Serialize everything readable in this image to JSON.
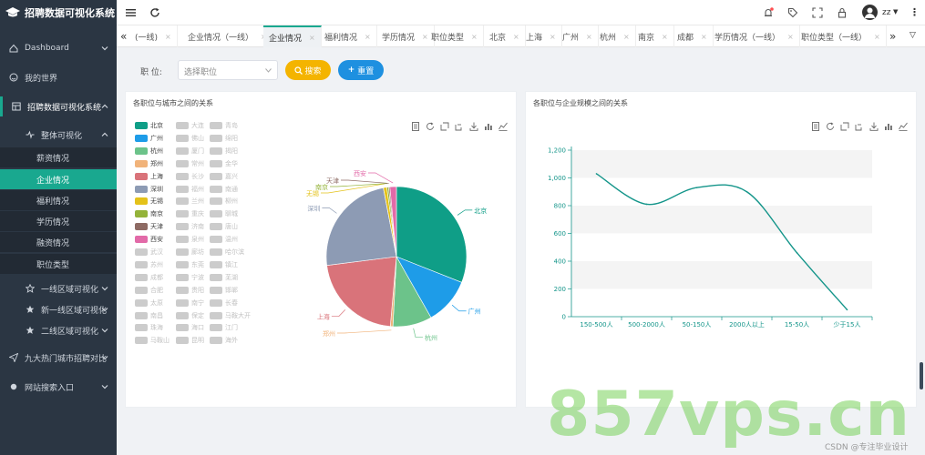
{
  "brand": {
    "title": "招聘数据可视化系统"
  },
  "sidebar": {
    "items": [
      {
        "label": "Dashboard",
        "icon": "dashboard-icon"
      },
      {
        "label": "我的世界",
        "icon": "globe-icon"
      },
      {
        "label": "招聘数据可视化系统",
        "icon": "table-icon"
      },
      {
        "label": "整体可视化",
        "icon": "pulse-icon"
      },
      {
        "label": "一线区域可视化",
        "icon": "star-outline-icon"
      },
      {
        "label": "新一线区域可视化",
        "icon": "star-icon"
      },
      {
        "label": "二线区域可视化",
        "icon": "star-icon"
      },
      {
        "label": "九大热门城市招聘对比",
        "icon": "send-icon"
      },
      {
        "label": "网站搜索入口",
        "icon": "dot-icon"
      }
    ],
    "sub_items": [
      "薪资情况",
      "企业情况",
      "福利情况",
      "学历情况",
      "融资情况",
      "职位类型"
    ]
  },
  "topnav": {
    "user": "zz"
  },
  "tabs": [
    "(一线)",
    "企业情况（一线）",
    "企业情况",
    "福利情况",
    "学历情况",
    "职位类型",
    "北京",
    "上海",
    "广州",
    "杭州",
    "南京",
    "成都",
    "学历情况（一线）",
    "职位类型（一线）"
  ],
  "filter": {
    "label": "职 位:",
    "placeholder": "选择职位",
    "search_label": "搜索",
    "reset_label": "重置"
  },
  "colors": {
    "accent": "#19a88f",
    "sidebar": "#2b3643",
    "search": "#f4b400",
    "reset": "#1e90e0"
  },
  "pie_panel": {
    "title": "各职位与城市之间的关系",
    "legend_col1": [
      {
        "name": "北京",
        "color": "#0f9e87",
        "active": true
      },
      {
        "name": "广州",
        "color": "#1e9ce8",
        "active": true
      },
      {
        "name": "杭州",
        "color": "#6cc38a",
        "active": true
      },
      {
        "name": "郑州",
        "color": "#f1b37a",
        "active": true
      },
      {
        "name": "上海",
        "color": "#d9737a",
        "active": true
      },
      {
        "name": "深圳",
        "color": "#8d9bb4",
        "active": true
      },
      {
        "name": "无锡",
        "color": "#e4c21a",
        "active": true
      },
      {
        "name": "南京",
        "color": "#94b33a",
        "active": true
      },
      {
        "name": "天津",
        "color": "#8e6b64",
        "active": true
      },
      {
        "name": "西安",
        "color": "#e26aa8",
        "active": true
      },
      {
        "name": "武汉",
        "color": "#cccccc",
        "active": false
      },
      {
        "name": "苏州",
        "color": "#cccccc",
        "active": false
      },
      {
        "name": "成都",
        "color": "#cccccc",
        "active": false
      },
      {
        "name": "合肥",
        "color": "#cccccc",
        "active": false
      },
      {
        "name": "太原",
        "color": "#cccccc",
        "active": false
      },
      {
        "name": "南昌",
        "color": "#cccccc",
        "active": false
      },
      {
        "name": "珠海",
        "color": "#cccccc",
        "active": false
      },
      {
        "name": "马鞍山",
        "color": "#cccccc",
        "active": false
      }
    ],
    "legend_col2": [
      "大连",
      "佛山",
      "厦门",
      "常州",
      "长沙",
      "福州",
      "兰州",
      "重庆",
      "济南",
      "泉州",
      "廊坊",
      "东莞",
      "宁波",
      "贵阳",
      "南宁",
      "保定",
      "海口",
      "昆明"
    ],
    "legend_col3": [
      "青岛",
      "绵阳",
      "揭阳",
      "金华",
      "嘉兴",
      "南通",
      "柳州",
      "聊城",
      "唐山",
      "温州",
      "哈尔滨",
      "镇江",
      "芜湖",
      "邯郸",
      "长春",
      "马鞍大开",
      "江门",
      "海外"
    ]
  },
  "chart_data": [
    {
      "type": "pie",
      "title": "各职位与城市之间的关系",
      "categories": [
        "北京",
        "广州",
        "杭州",
        "郑州",
        "上海",
        "深圳",
        "无锡",
        "南京",
        "天津",
        "西安"
      ],
      "values": [
        31.0,
        10.8,
        9.0,
        0.6,
        21.6,
        24.0,
        0.8,
        0.4,
        0.3,
        1.5
      ],
      "unit": "%"
    },
    {
      "type": "line",
      "title": "各职位与企业规模之间的关系",
      "categories": [
        "150-500人",
        "500-2000人",
        "50-150人",
        "2000人以上",
        "15-50人",
        "少于15人"
      ],
      "values": [
        1030,
        810,
        930,
        900,
        460,
        50
      ],
      "ylim": [
        0,
        1200
      ],
      "yticks": [
        "0",
        "200",
        "400",
        "600",
        "800",
        "1,000",
        "1,200"
      ],
      "smooth": true,
      "color": "#14958a"
    }
  ],
  "line_panel": {
    "title": "各职位与企业规模之间的关系"
  },
  "watermark": "857vps.cn",
  "footer": "CSDN @专注毕业设计"
}
